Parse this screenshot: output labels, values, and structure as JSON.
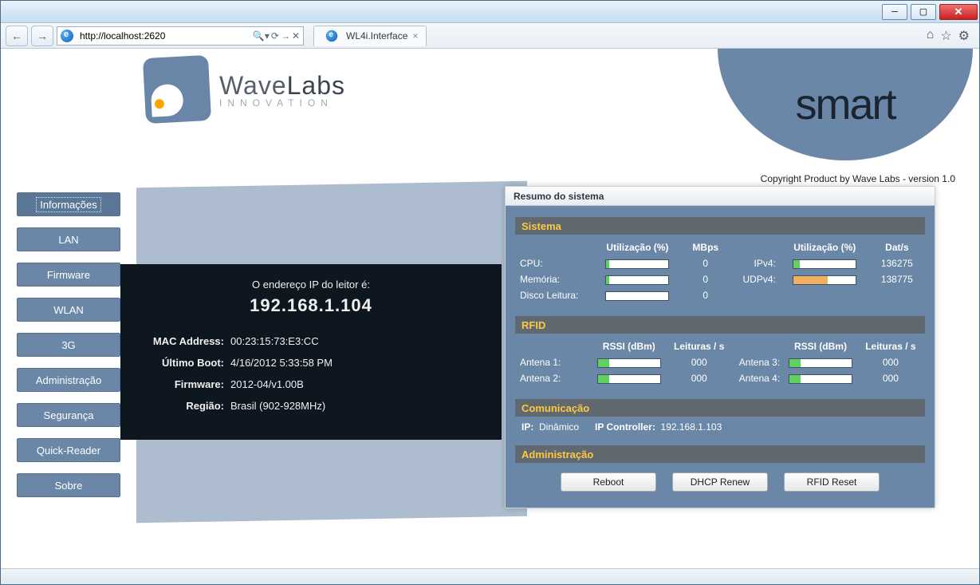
{
  "browser": {
    "url": "http://localhost:2620",
    "tab_title": "WL4i.Interface"
  },
  "header": {
    "brand_main": "Wave",
    "brand_bold": "Labs",
    "brand_sub": "INNOVATION",
    "smart": "smart",
    "copyright": "Copyright Product by Wave Labs - version 1.0"
  },
  "sidebar": {
    "items": [
      "Informações",
      "LAN",
      "Firmware",
      "WLAN",
      "3G",
      "Administração",
      "Segurança",
      "Quick-Reader",
      "Sobre"
    ]
  },
  "info": {
    "ip_label": "O endereço IP do leitor é:",
    "ip_value": "192.168.1.104",
    "mac_label": "MAC Address:",
    "mac": "00:23:15:73:E3:CC",
    "boot_label": "Último Boot:",
    "boot": "4/16/2012 5:33:58 PM",
    "fw_label": "Firmware:",
    "fw": "2012-04/v1.00B",
    "region_label": "Região:",
    "region": "Brasil (902-928MHz)"
  },
  "resumo": {
    "title": "Resumo do sistema",
    "sistema": {
      "header": "Sistema",
      "col_util": "Utilização (%)",
      "col_mbps": "MBps",
      "col_util2": "Utilização (%)",
      "col_dats": "Dat/s",
      "rows_left": [
        {
          "label": "CPU:",
          "util": 5,
          "mbps": "0"
        },
        {
          "label": "Memória:",
          "util": 5,
          "mbps": "0"
        },
        {
          "label": "Disco Leitura:",
          "util": 0,
          "mbps": "0"
        }
      ],
      "rows_right": [
        {
          "label": "IPv4:",
          "util": 10,
          "color": "green",
          "dats": "136275"
        },
        {
          "label": "UDPv4:",
          "util": 55,
          "color": "orange",
          "dats": "138775"
        }
      ]
    },
    "rfid": {
      "header": "RFID",
      "col_rssi": "RSSI (dBm)",
      "col_reads": "Leituras / s",
      "antennas": [
        {
          "label": "Antena 1:",
          "rssi": 18,
          "reads": "000"
        },
        {
          "label": "Antena 2:",
          "rssi": 18,
          "reads": "000"
        },
        {
          "label": "Antena 3:",
          "rssi": 18,
          "reads": "000"
        },
        {
          "label": "Antena 4:",
          "rssi": 18,
          "reads": "000"
        }
      ]
    },
    "comm": {
      "header": "Comunicação",
      "ip_label": "IP:",
      "ip_mode": "Dinâmico",
      "ctrl_label": "IP Controller:",
      "ctrl_ip": "192.168.1.103"
    },
    "admin": {
      "header": "Administração",
      "buttons": [
        "Reboot",
        "DHCP Renew",
        "RFID Reset"
      ]
    }
  }
}
